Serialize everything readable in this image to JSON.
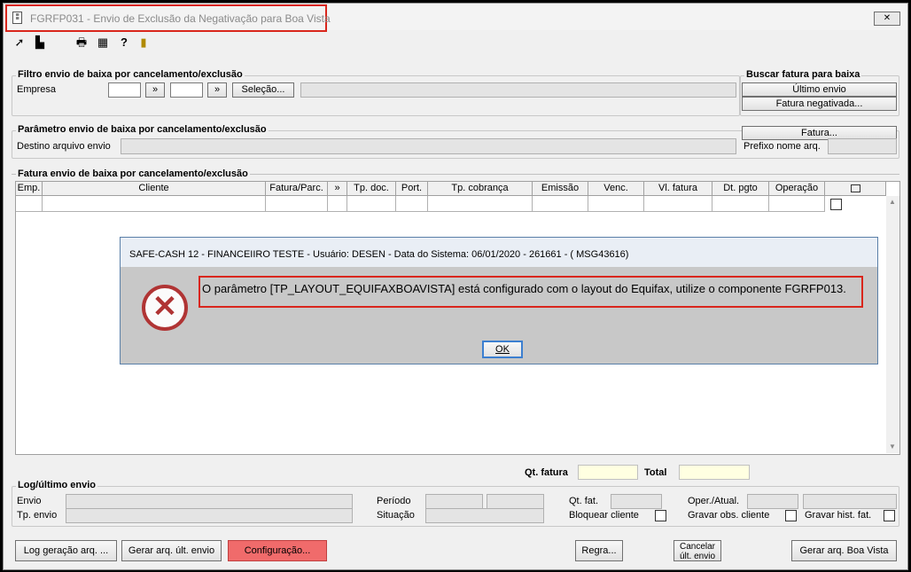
{
  "window": {
    "title": "FGRFP031 - Envio de Exclusão da Negativação para Boa Vista",
    "close_label": "✕"
  },
  "filtro": {
    "title": "Filtro envio de baixa por cancelamento/exclusão",
    "empresa_label": "Empresa",
    "arrow1": "»",
    "arrow2": "»",
    "selecao_label": "Seleção..."
  },
  "buscar": {
    "title": "Buscar fatura para baixa",
    "ultimo_envio": "Último envio",
    "fatura_negativada": "Fatura negativada..."
  },
  "parametro": {
    "title": "Parâmetro envio de baixa por cancelamento/exclusão",
    "destino_label": "Destino arquivo envio",
    "fatura_button": "Fatura...",
    "prefixo_label": "Prefixo nome arq."
  },
  "grid": {
    "title": "Fatura envio de baixa por cancelamento/exclusão",
    "columns": [
      "Emp.",
      "Cliente",
      "Fatura/Parc.",
      "»",
      "Tp. doc.",
      "Port.",
      "Tp. cobrança",
      "Emissão",
      "Venc.",
      "Vl. fatura",
      "Dt. pgto",
      "Operação"
    ]
  },
  "dialog": {
    "title": "SAFE-CASH 12 - FINANCEIIRO TESTE - Usuário: DESEN - Data do Sistema: 06/01/2020 - 261661 - ( MSG43616)",
    "message": "O parâmetro [TP_LAYOUT_EQUIFAXBOAVISTA] está configurado com o layout do Equifax, utilize o componente FGRFP013.",
    "ok_label": "OK",
    "icon": "error-icon"
  },
  "totals": {
    "qt_fatura_label": "Qt. fatura",
    "total_label": "Total"
  },
  "log": {
    "title": "Log/último envio",
    "envio_label": "Envio",
    "tp_envio_label": "Tp. envio",
    "periodo_label": "Período",
    "situacao_label": "Situação",
    "qt_fat_label": "Qt. fat.",
    "bloquear_label": "Bloquear cliente",
    "oper_atual_label": "Oper./Atual.",
    "gravar_obs_label": "Gravar obs. cliente",
    "gravar_hist_label": "Gravar hist. fat."
  },
  "footer": {
    "log_geracao": "Log geração arq. ...",
    "gerar_ult": "Gerar arq. últ. envio",
    "configuracao": "Configuração...",
    "regra": "Regra...",
    "cancelar_line1": "Cancelar",
    "cancelar_line2": "últ. envio",
    "gerar_boa_vista": "Gerar arq. Boa Vista"
  },
  "colors": {
    "highlight_red": "#d9261c",
    "config_button": "#f06b6b",
    "dialog_bg": "#c8c8c8",
    "dialog_border": "#5a7fa8"
  }
}
